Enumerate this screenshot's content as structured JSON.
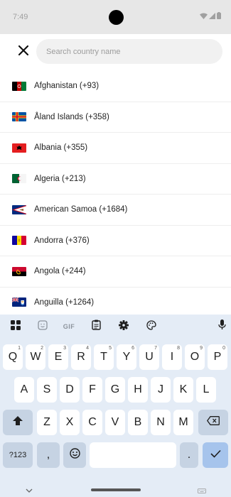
{
  "status_bar": {
    "time": "7:49"
  },
  "search": {
    "placeholder": "Search country name",
    "value": ""
  },
  "countries": [
    {
      "label": "Afghanistan (+93)",
      "flag": "af"
    },
    {
      "label": "Åland Islands (+358)",
      "flag": "ax"
    },
    {
      "label": "Albania (+355)",
      "flag": "al"
    },
    {
      "label": "Algeria (+213)",
      "flag": "dz"
    },
    {
      "label": "American Samoa (+1684)",
      "flag": "as"
    },
    {
      "label": "Andorra (+376)",
      "flag": "ad"
    },
    {
      "label": "Angola (+244)",
      "flag": "ao"
    },
    {
      "label": "Anguilla (+1264)",
      "flag": "ai"
    }
  ],
  "keyboard": {
    "toolbar": {
      "gif_label": "GIF"
    },
    "row1": [
      {
        "key": "Q",
        "hint": "1"
      },
      {
        "key": "W",
        "hint": "2"
      },
      {
        "key": "E",
        "hint": "3"
      },
      {
        "key": "R",
        "hint": "4"
      },
      {
        "key": "T",
        "hint": "5"
      },
      {
        "key": "Y",
        "hint": "6"
      },
      {
        "key": "U",
        "hint": "7"
      },
      {
        "key": "I",
        "hint": "8"
      },
      {
        "key": "O",
        "hint": "9"
      },
      {
        "key": "P",
        "hint": "0"
      }
    ],
    "row2": [
      "A",
      "S",
      "D",
      "F",
      "G",
      "H",
      "J",
      "K",
      "L"
    ],
    "row3": [
      "Z",
      "X",
      "C",
      "V",
      "B",
      "N",
      "M"
    ],
    "symbols_label": "?123",
    "comma_label": ",",
    "period_label": "."
  },
  "colors": {
    "keyboard_bg": "#e4ecf6",
    "function_key": "#c6d3e3",
    "enter_key": "#a6c4ec",
    "status_bar": "#e7e7e7"
  }
}
